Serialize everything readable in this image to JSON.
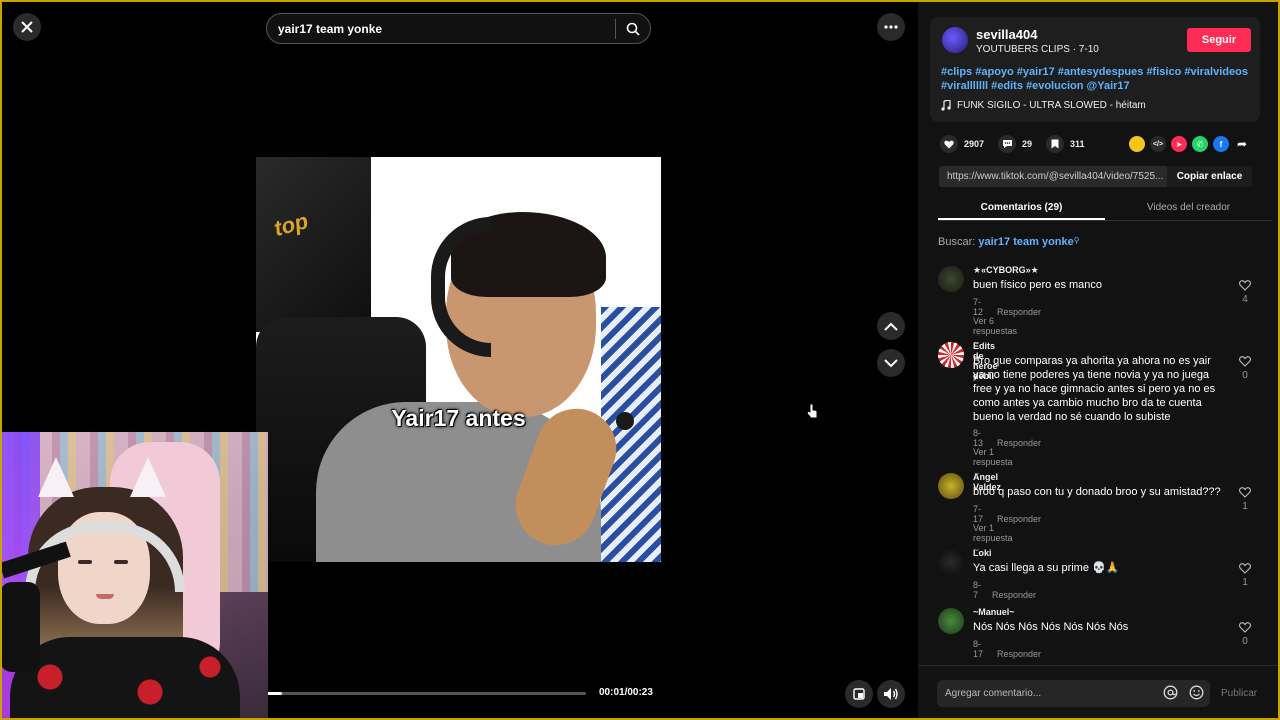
{
  "search": {
    "query": "yair17 team yonke"
  },
  "video": {
    "caption": "Yair17 antes",
    "time": "00:01/00:23",
    "progress": 0.05
  },
  "creator": {
    "name": "sevilla404",
    "subtitle": "YOUTUBERS CLIPS · 7-10",
    "follow_label": "Seguir",
    "description_line1": "#clips #apoyo #yair17 #antesydespues #fisico #viralvideos",
    "description_line2": "#viralllllll #edits #evolucion @Yair17",
    "music": "FUNK SIGILO - ULTRA SLOWED - héitam"
  },
  "stats": {
    "likes": "2907",
    "comments": "29",
    "saves": "311"
  },
  "link": {
    "url": "https://www.tiktok.com/@sevilla404/video/7525...",
    "copy_label": "Copiar enlace"
  },
  "tabs": [
    {
      "label": "Comentarios (29)"
    },
    {
      "label": "Videos del creador"
    }
  ],
  "comment_search": {
    "prefix": "Buscar:",
    "query": "yair17 team yonke"
  },
  "comments": [
    {
      "name": "★«CYBORG»★",
      "text": "buen físico pero es manco",
      "date": "7-12",
      "reply": "Responder",
      "replies": "Ver 6 respuestas",
      "likes": "4"
    },
    {
      "name": "Edits de héroe débil",
      "text": "Bro que comparas ya ahorita ya ahora no es yair ya no tiene poderes ya tiene novia y ya no juega free y ya no hace gimnacio antes si pero ya no es como antes ya cambio mucho bro da te cuenta bueno la verdad no sé cuando lo subiste",
      "date": "8-13",
      "reply": "Responder",
      "replies": "Ver 1 respuesta",
      "likes": "0"
    },
    {
      "name": "Angel Valdez",
      "text": "broo q paso con tu y donado broo y su amistad???",
      "date": "7-17",
      "reply": "Responder",
      "replies": "Ver 1 respuesta",
      "likes": "1"
    },
    {
      "name": "Loki",
      "text": "Ya casi llega a su prime 💀🙏",
      "date": "8-7",
      "reply": "Responder",
      "replies": "",
      "likes": "1"
    },
    {
      "name": "~Manuel~",
      "text": "Nós Nós Nós Nós Nós Nós Nós",
      "date": "8-17",
      "reply": "Responder",
      "replies": "",
      "likes": "0"
    }
  ],
  "comment_input": {
    "placeholder": "Agregar comentario...",
    "publish_label": "Publicar"
  },
  "colors": {
    "accent": "#fe2c55",
    "link": "#5eb3ff",
    "panel": "#121212",
    "frame": "#c9a400"
  }
}
